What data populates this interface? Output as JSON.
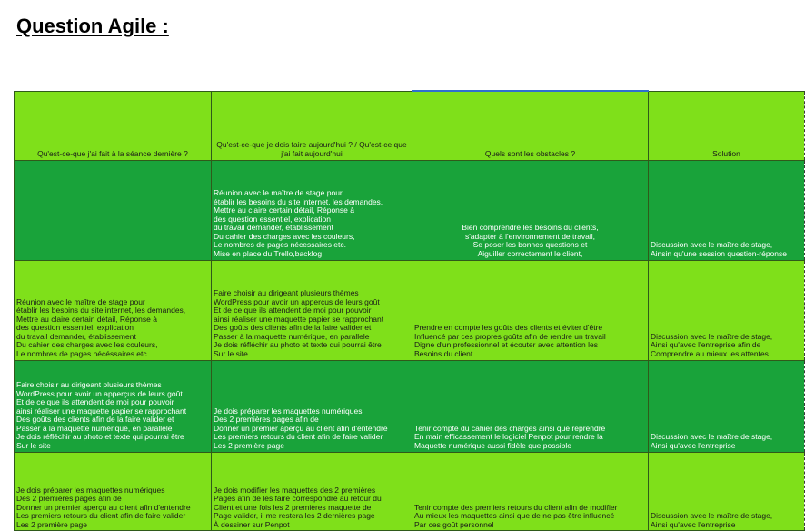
{
  "title": "Question Agile :",
  "headers": [
    "Qu'est-ce-que j'ai fait à la séance dernière ?",
    "Qu'est-ce-que je dois faire aujourd'hui ? / Qu'est-ce que j'ai fait aujourd'hui",
    "Quels sont les obstacles ?",
    "Solution"
  ],
  "rows": [
    {
      "c1": "",
      "c2": "Réunion avec le maître de stage pour\nétablir les besoins du site internet, les demandes,\nMettre au claire certain détail, Réponse à\ndes question essentiel, explication\ndu travail demander, établissement\n Du cahier des charges avec les couleurs,\nLe nombres de pages nécessaires etc.\nMise en place du Trello,backlog",
      "c3": "Bien comprendre les besoins du clients,\ns'adapter à l'environnement de travail,\nSe poser les bonnes questions et\nAiguiller correctement le client,",
      "c4": "Discussion avec le maître de stage,\nAinsin qu'une session question-réponse"
    },
    {
      "c1": "Réunion avec le maître de stage pour\nétablir les besoins du site internet, les demandes,\nMettre au claire certain détail, Réponse à\ndes question essentiel, explication\ndu travail demander, établissement\n Du cahier des charges avec les couleurs,\nLe nombres de pages nécéssaires etc...",
      "c2": "Faire choisir au dirigeant plusieurs thèmes\nWordPress pour avoir un apperçus de leurs goût\nEt de ce que ils attendent de moi pour pouvoir\nainsi réaliser une maquette papier se rapprochant\nDes goûts des clients afin de la faire valider et\nPasser à la maquette numérique, en parallele\nJe dois réfléchir au photo et texte qui pourrai être\nSur le site",
      "c3": "Prendre en compte les goûts des clients et éviter d'être\nInfluencé par ces propres goûts afin de rendre un travail\nDigne d'un professionnel et écouter avec attention les\nBesoins du client.",
      "c4": "Discussion avec le maître de stage,\nAinsi qu'avec l'entreprise afin de\nComprendre au mieux les attentes."
    },
    {
      "c1": "Faire choisir au dirigeant plusieurs thèmes\nWordPress pour avoir un apperçus de leurs goût\nEt de ce que ils attendent de moi pour pouvoir\nainsi réaliser une maquette papier se rapprochant\nDes goûts des clients afin de la faire valider et\nPasser à la maquette numérique, en parallele\nJe dois réfléchir au photo et texte qui pourrai être\nSur le site",
      "c2": "Je dois préparer les maquettes numériques\nDes 2 premières pages  afin de\nDonner un premier aperçu au client afin d'entendre\nLes premiers retours du client afin de faire valider\nLes 2 première page",
      "c3": "Tenir compte du cahier des charges ainsi que reprendre\nEn main efficassement le logiciel Penpot pour rendre la\nMaquette numérique aussi fidèle que possible",
      "c4": "Discussion avec le maître de stage,\nAinsi qu'avec l'entreprise"
    },
    {
      "c1": "Je dois préparer les maquettes numériques\nDes 2 premières pages  afin de\nDonner un premier aperçu au client afin d'entendre\nLes premiers retours du client afin de faire valider\nLes 2 première page",
      "c2": "Je dois modifier les maquettes des 2 premières\nPages afin de les faire correspondre au retour du\nClient et une fois les 2 premières maquette de\nPage valider, il me restera les 2 dernières page\nÀ dessiner sur Penpot",
      "c3": "Tenir compte des premiers retours du client afin de modifier\nAu mieux les maquettes ainsi que de ne pas être influencé\nPar ces goût personnel",
      "c4": "Discussion avec le maître de stage,\n Ainsi qu'avec l'entreprise"
    }
  ]
}
